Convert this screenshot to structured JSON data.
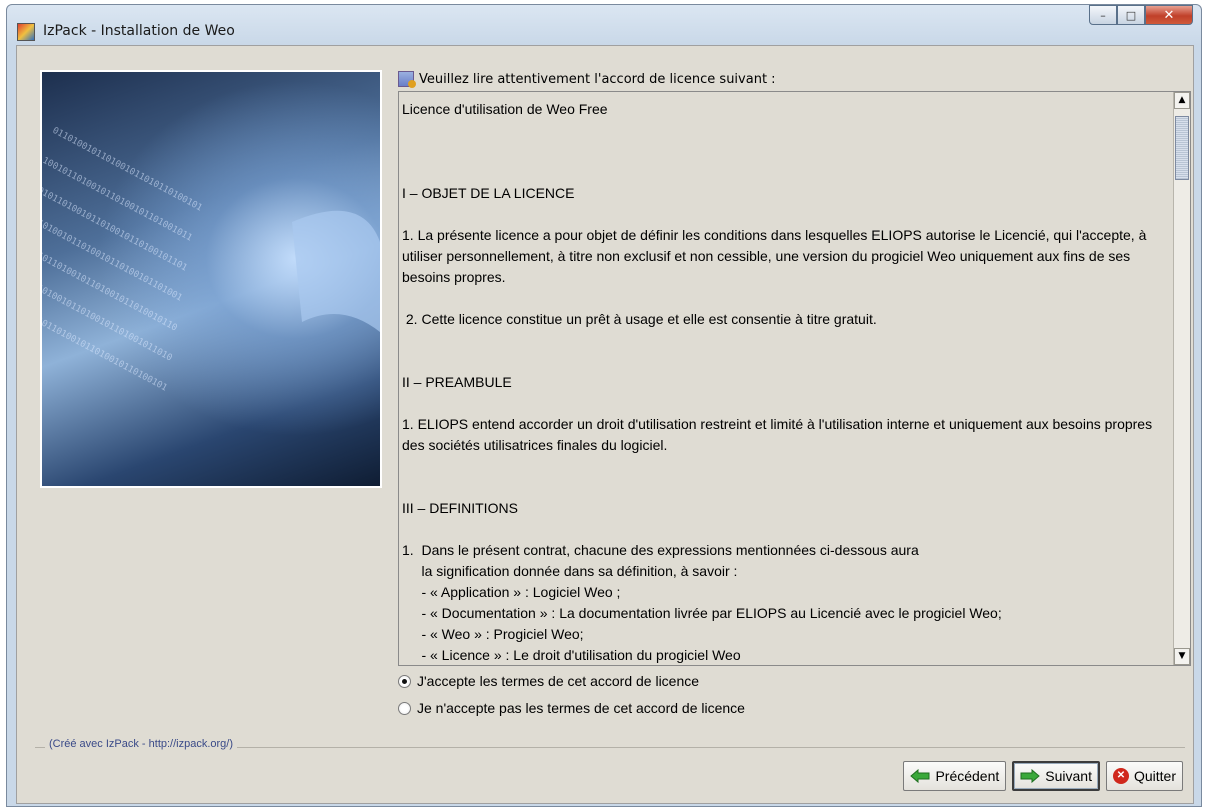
{
  "window": {
    "title": "IzPack - Installation de Weo",
    "minimize_glyph": "–",
    "maximize_glyph": "□",
    "close_glyph": "✕"
  },
  "license": {
    "header": "Veuillez lire attentivement l'accord de licence suivant :",
    "text": "Licence d'utilisation de Weo Free\n\n\n\nI – OBJET DE LA LICENCE\n\n1. La présente licence a pour objet de définir les conditions dans lesquelles ELIOPS autorise le Licencié, qui l'accepte, à utiliser personnellement, à titre non exclusif et non cessible, une version du progiciel Weo uniquement aux fins de ses besoins propres.\n\n 2. Cette licence constitue un prêt à usage et elle est consentie à titre gratuit.\n\n\nII – PREAMBULE\n\n1. ELIOPS entend accorder un droit d'utilisation restreint et limité à l'utilisation interne et uniquement aux besoins propres des sociétés utilisatrices finales du logiciel.\n\n\nIII – DEFINITIONS\n\n1.  Dans le présent contrat, chacune des expressions mentionnées ci-dessous aura\n     la signification donnée dans sa définition, à savoir :\n     - « Application » : Logiciel Weo ;\n     - « Documentation » : La documentation livrée par ELIOPS au Licencié avec le progiciel Weo;\n     - « Weo » : Progiciel Weo;\n     - « Licence » : Le droit d'utilisation du progiciel Weo"
  },
  "options": {
    "accept": "J'accepte les termes de cet accord de licence",
    "decline": "Je n'accepte pas les termes de cet accord de licence",
    "selected": "accept"
  },
  "footer": {
    "credit": "(Créé avec IzPack - http://izpack.org/)"
  },
  "buttons": {
    "previous": "Précédent",
    "next": "Suivant",
    "quit": "Quitter"
  },
  "colors": {
    "arrow_green": "#3aa83a",
    "quit_red": "#d0281c",
    "credit_blue": "#3a4a88"
  },
  "icons": {
    "header": "license-doc-icon",
    "previous": "arrow-left-icon",
    "next": "arrow-right-icon",
    "quit": "close-circle-icon"
  }
}
